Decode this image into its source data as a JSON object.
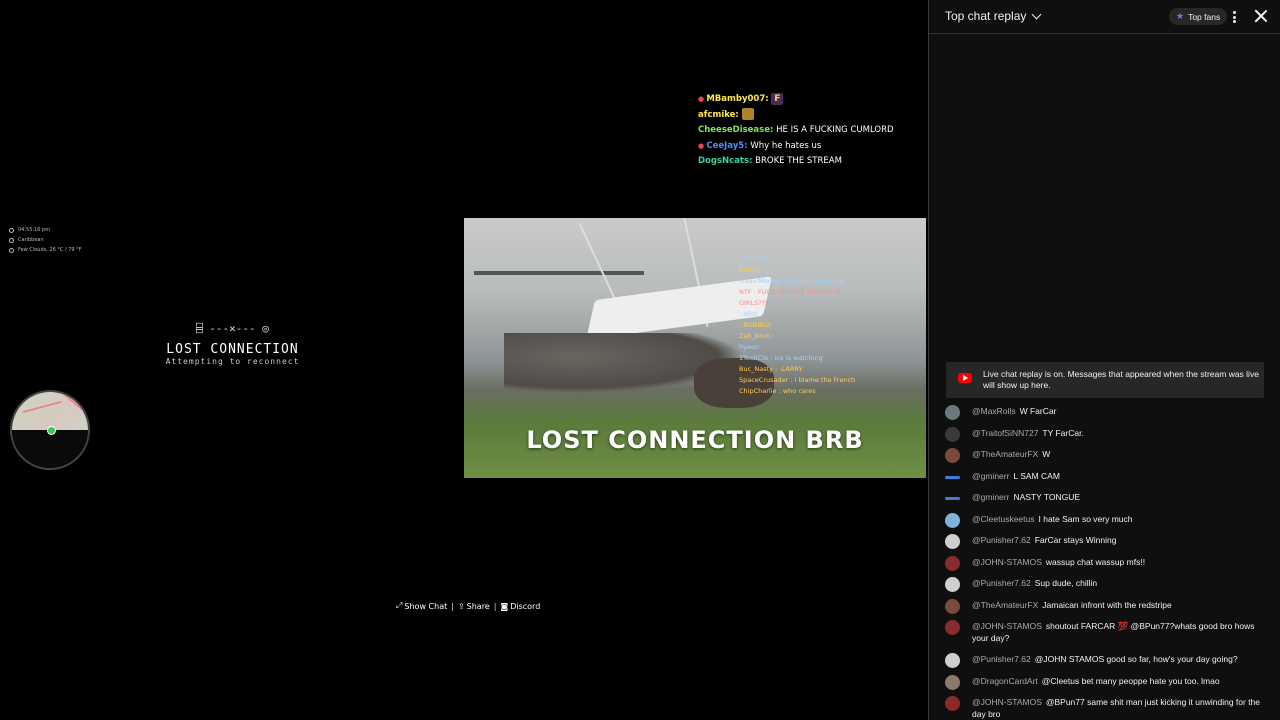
{
  "overlay_info": {
    "time": "04:55:16 pm",
    "location": "Caribbean",
    "weather": "Few Clouds, 26 °C / 79 °F"
  },
  "lost_connection": {
    "icons": "---✕---",
    "title": "LOST CONNECTION",
    "subtitle": "Attempting to reconnect"
  },
  "stream_chat": [
    {
      "user": "MBamby007:",
      "text": "",
      "color": "y",
      "pinned": true,
      "emote": "F"
    },
    {
      "user": "afcmike:",
      "text": "",
      "color": "y",
      "pinned": false,
      "emote": "img"
    },
    {
      "user": "CheeseDisease:",
      "text": "HE IS A FUCKING CUMLORD",
      "color": "g",
      "pinned": false,
      "emote": ""
    },
    {
      "user": "CeeJay5:",
      "text": "Why he hates us",
      "color": "b",
      "pinned": true,
      "emote": ""
    },
    {
      "user": "DogsNcats:",
      "text": "BROKE THE STREAM",
      "color": "t",
      "pinned": false,
      "emote": ""
    }
  ],
  "video": {
    "overlay_text": "LOST CONNECTION BRB",
    "inner_chat": [
      {
        "user": ": Tatical F",
        "cls": "n1"
      },
      {
        "user": "Zaturn",
        "cls": "n2"
      },
      {
        "user": "MaxxiMoney : id break skins jaw",
        "cls": "n1"
      },
      {
        "user": "NTF : FUCK UP SHYE INSTED OF",
        "cls": "n3"
      },
      {
        "user": "GIRLS???",
        "cls": "n3"
      },
      {
        "user": ": Idiot",
        "cls": "n1"
      },
      {
        "user": ": ROBBED",
        "cls": "n2"
      },
      {
        "user": "Zah_Bruh :",
        "cls": "n2"
      },
      {
        "user": "hyeon",
        "cls": "n1"
      },
      {
        "user": "1TestiCle : ice is watching",
        "cls": "n1"
      },
      {
        "user": "Buc_Nasty : -LARRY",
        "cls": "n2"
      },
      {
        "user": "SpaceCrusader : I blame the French",
        "cls": "n2"
      },
      {
        "user": "ChipCharlie : who cares",
        "cls": "n2"
      }
    ]
  },
  "bottom_links": {
    "show_chat": "Show Chat",
    "share": "Share",
    "discord": "Discord",
    "separator": "|"
  },
  "chat_panel": {
    "title": "Top chat replay",
    "top_fans": "Top fans",
    "replay_note": "Live chat replay is on. Messages that appeared when the stream was live will show up here.",
    "messages": [
      {
        "user": "@MaxRolls",
        "text": "W FarCar",
        "avatar": "#6a7a7c",
        "bar": false
      },
      {
        "user": "@TraitofSiNN727",
        "text": "TY FarCar.",
        "avatar": "#3a3a3a",
        "bar": false
      },
      {
        "user": "@TheAmateurFX",
        "text": "W",
        "avatar": "#7a4a3c",
        "bar": false
      },
      {
        "user": "@gminerr",
        "text": "L SAM CAM",
        "avatar": "#3e7fd6",
        "bar": true
      },
      {
        "user": "@gminerr",
        "text": "NASTY TONGUE",
        "avatar": "#3e7fd6",
        "bar": true
      },
      {
        "user": "@Cleetuskeetus",
        "text": "I hate Sam so very much",
        "avatar": "#7fb4d8",
        "bar": false
      },
      {
        "user": "@Punisher7.62",
        "text": "FarCar stays Winning",
        "avatar": "#cfcfcf",
        "bar": false
      },
      {
        "user": "@JOHN-STAMOS",
        "text": "wassup chat wassup mfs!!",
        "avatar": "#8a2a2a",
        "bar": false
      },
      {
        "user": "@Punisher7.62",
        "text": "Sup dude, chillin",
        "avatar": "#cfcfcf",
        "bar": false
      },
      {
        "user": "@TheAmateurFX",
        "text": "Jamaican infront with the redstripe",
        "avatar": "#7a4a3c",
        "bar": false
      },
      {
        "user": "@JOHN-STAMOS",
        "text": "shoutout FARCAR 💯 @BPun77?whats good bro hows your day?",
        "avatar": "#8a2a2a",
        "bar": false
      },
      {
        "user": "@Punisher7.62",
        "text": "@JOHN STAMOS good so far, how's your day going?",
        "avatar": "#cfcfcf",
        "bar": false
      },
      {
        "user": "@DragonCardArt",
        "text": "@Cleetus bet many peoppe hate you too. lmao",
        "avatar": "#8a7a6a",
        "bar": false
      },
      {
        "user": "@JOHN-STAMOS",
        "text": "@BPun77 same shit man just kicking it unwinding for the day bro",
        "avatar": "#8a2a2a",
        "bar": false
      }
    ]
  }
}
